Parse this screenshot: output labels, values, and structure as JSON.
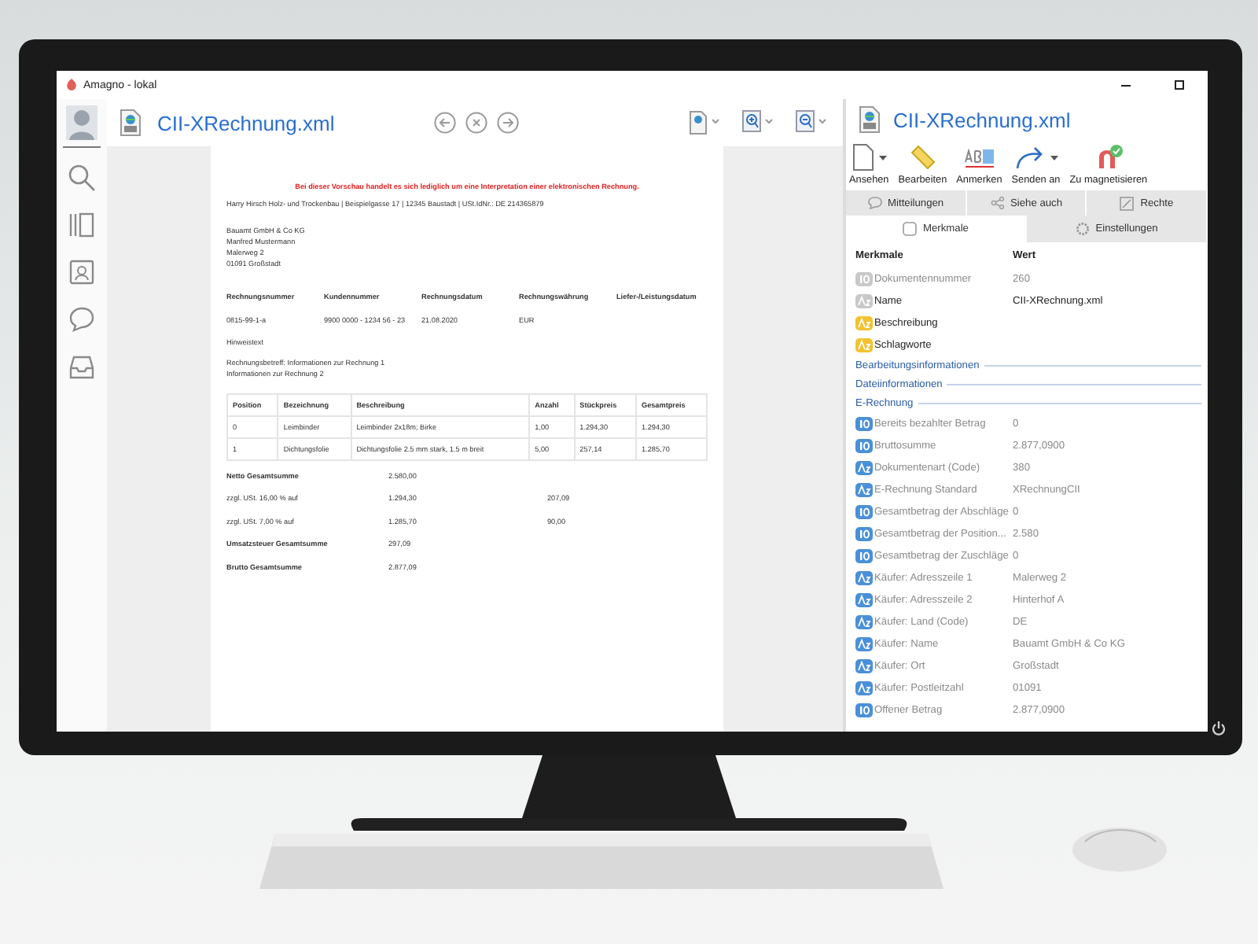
{
  "window": {
    "title": "Amagno - lokal"
  },
  "viewer": {
    "title": "CII-XRechnung.xml"
  },
  "document": {
    "notice": "Bei dieser Vorschau handelt es sich lediglich um eine Interpretation einer elektronischen Rechnung.",
    "sender_line": "Harry Hirsch Holz- und Trockenbau | Beispielgasse 17 | 12345 Baustadt | USt.IdNr.: DE 214365879",
    "recipient_lines": [
      "Bauamt GmbH & Co KG",
      "Manfred Mustermann",
      "Malerweg 2",
      "01091 Großstadt"
    ],
    "meta_columns": [
      "Rechnungsnummer",
      "Kundennummer",
      "Rechnungsdatum",
      "Rechnungswährung",
      "Liefer-/Leistungsdatum"
    ],
    "meta_values": [
      "0815-99-1-a",
      "9900 0000 - 1234 56 - 23",
      "21.08.2020",
      "EUR"
    ],
    "hint": "Hinweistext",
    "subject_lines": [
      "Rechnungsbetreff: Informationen zur Rechnung 1",
      "Informationen zur Rechnung 2"
    ],
    "item_columns": [
      "Position",
      "Bezeichnung",
      "Beschreibung",
      "Anzahl",
      "Stückpreis",
      "Gesamtpreis"
    ],
    "item_rows": [
      [
        "0",
        "Leimbinder",
        "Leimbinder 2x18m; Birke",
        "1,00",
        "1.294,30",
        "1.294,30"
      ],
      [
        "1",
        "Dichtungsfolie",
        "Dichtungsfolie 2.5 mm stark, 1.5 m breit",
        "5,00",
        "257,14",
        "1.285,70"
      ]
    ],
    "totals": [
      {
        "kind": "sum",
        "label": "Netto Gesamtsumme",
        "base": "2.580,00"
      },
      {
        "kind": "tax",
        "label": "zzgl. USt. 16,00 % auf",
        "base": "1.294,30",
        "amount": "207,09"
      },
      {
        "kind": "tax",
        "label": "zzgl. USt. 7,00 % auf",
        "base": "1.285,70",
        "amount": "90,00"
      },
      {
        "kind": "sum",
        "label": "Umsatzsteuer Gesamtsumme",
        "base": "297,09"
      },
      {
        "kind": "sum",
        "label": "Brutto Gesamtsumme",
        "base": "2.877,09"
      }
    ]
  },
  "panel": {
    "title": "CII-XRechnung.xml",
    "toolbar": [
      {
        "label": "Ansehen",
        "menu": true
      },
      {
        "label": "Bearbeiten",
        "menu": false
      },
      {
        "label": "Anmerken",
        "menu": false
      },
      {
        "label": "Senden an",
        "menu": true
      },
      {
        "label": "Zu magnetisieren",
        "menu": false
      }
    ],
    "tabs": [
      {
        "label": "Mitteilungen",
        "selected": false
      },
      {
        "label": "Siehe auch",
        "selected": false
      },
      {
        "label": "Rechte",
        "selected": false
      }
    ],
    "subtabs": [
      {
        "label": "Merkmale",
        "selected": true
      },
      {
        "label": "Einstellungen",
        "selected": false
      }
    ],
    "columns": [
      "Merkmale",
      "Wert"
    ],
    "rows": [
      {
        "kind": "number",
        "color": "#c8c8c8",
        "disabled": true,
        "label": "Dokumentennummer",
        "value": "260"
      },
      {
        "kind": "text",
        "color": "#c8c8c8",
        "disabled": false,
        "label": "Name",
        "value": "CII-XRechnung.xml"
      },
      {
        "kind": "text",
        "color": "#f2c230",
        "disabled": false,
        "label": "Beschreibung"
      },
      {
        "kind": "text",
        "color": "#f2c230",
        "disabled": false,
        "label": "Schlagworte"
      }
    ],
    "sections": [
      {
        "title": "Bearbeitungsinformationen"
      },
      {
        "title": "Dateiinformationen"
      },
      {
        "title": "E-Rechnung",
        "rows": [
          {
            "kind": "number",
            "color": "#4a90d9",
            "disabled": true,
            "label": "Bereits bezahlter Betrag",
            "value": "0"
          },
          {
            "kind": "number",
            "color": "#4a90d9",
            "disabled": true,
            "label": "Bruttosumme",
            "value": "2.877,0900"
          },
          {
            "kind": "text",
            "color": "#4a90d9",
            "disabled": true,
            "label": "Dokumentenart (Code)",
            "value": "380"
          },
          {
            "kind": "text",
            "color": "#4a90d9",
            "disabled": true,
            "label": "E-Rechnung Standard",
            "value": "XRechnungCII"
          },
          {
            "kind": "number",
            "color": "#4a90d9",
            "disabled": true,
            "label": "Gesamtbetrag der Abschläge",
            "value": "0"
          },
          {
            "kind": "number",
            "color": "#4a90d9",
            "disabled": true,
            "label": "Gesamtbetrag der Position...",
            "value": "2.580"
          },
          {
            "kind": "number",
            "color": "#4a90d9",
            "disabled": true,
            "label": "Gesamtbetrag der Zuschläge",
            "value": "0"
          },
          {
            "kind": "text",
            "color": "#4a90d9",
            "disabled": true,
            "label": "Käufer: Adresszeile 1",
            "value": "Malerweg 2"
          },
          {
            "kind": "text",
            "color": "#4a90d9",
            "disabled": true,
            "label": "Käufer: Adresszeile 2",
            "value": "Hinterhof A"
          },
          {
            "kind": "text",
            "color": "#4a90d9",
            "disabled": true,
            "label": "Käufer: Land (Code)",
            "value": "DE"
          },
          {
            "kind": "text",
            "color": "#4a90d9",
            "disabled": true,
            "label": "Käufer: Name",
            "value": "Bauamt GmbH & Co KG"
          },
          {
            "kind": "text",
            "color": "#4a90d9",
            "disabled": true,
            "label": "Käufer: Ort",
            "value": "Großstadt"
          },
          {
            "kind": "text",
            "color": "#4a90d9",
            "disabled": true,
            "label": "Käufer: Postleitzahl",
            "value": "01091"
          },
          {
            "kind": "number",
            "color": "#4a90d9",
            "disabled": true,
            "label": "Offener Betrag",
            "value": "2.877,0900"
          }
        ]
      }
    ]
  }
}
